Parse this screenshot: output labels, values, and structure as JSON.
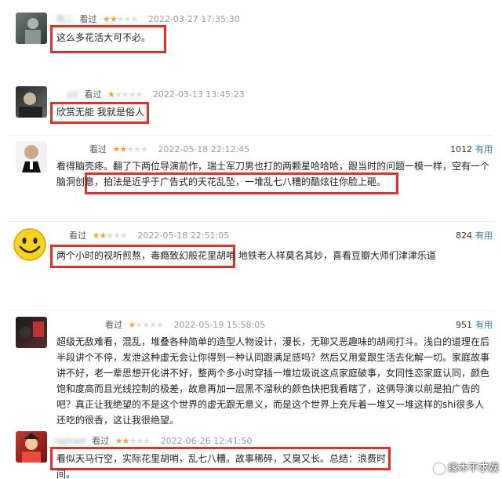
{
  "reviews": [
    {
      "user": "陈二",
      "watched": "看过",
      "stars": 2,
      "time": "2022-03-27 17:35:30",
      "text_before": "",
      "highlight": "这么多花活大可不必。",
      "text_after": "",
      "votes": "",
      "useful": ""
    },
    {
      "user": "p2",
      "watched": "看过",
      "stars": 1,
      "time": "2022-03-13 13:45:23",
      "text_before": "",
      "highlight": "欣赏无能 我就是俗人",
      "text_after": "",
      "votes": "",
      "useful": ""
    },
    {
      "user": "",
      "watched": "看过",
      "stars": 2,
      "time": "2022-05-18 22:12:45",
      "text_before": "看得脑壳疼。翻了下两位导演前作，瑞士军刀男也打的两颗星哈哈哈，跟当时的问题一模一样，空有一个脑洞创意，",
      "highlight": "拍法是近乎于广告式的天花乱坠，一堆乱七八糟的酷炫往你脸上砸。",
      "text_after": "",
      "votes": "1012",
      "useful": "有用"
    },
    {
      "user": "",
      "watched": "看过",
      "stars": 2,
      "time": "2022-05-18 22:51:05",
      "text_before": "",
      "highlight": "两个小时的视听煎熬，毒瘾致幻般花里胡哨",
      "text_after": " 地铁老人样莫名其妙，喜看豆瓣大师们津津乐道",
      "votes": "824",
      "useful": "有用"
    },
    {
      "user": "",
      "watched": "看过",
      "stars": 1,
      "time": "2022-05-19 15:58:05",
      "text_before": "超级无敌难看，混乱，堆叠各种简单的造型人物设计，漫长，无聊又恶趣味的胡闹打斗。浅白的道理在后半段讲个不停，发泄这种虚无会让你得到一种认同跟满足感吗？然后又用爱跟生活去化解一切。家庭故事讲不好，老一辈思想开化讲不好，整两个多小时穿插一堆垃圾说这点家庭破事，女同性恋家庭认同，颜色饱和度高而且光线控制的极差，故意再加一层黑不溜秋的颜色快把我看瞎了，这俩导演以前是拍广告的吧？真正让我绝望的不是这个世界的虚无跟无意义，而是这个世界上充斥着一堆又一堆这样的shi很多人还吃的很香，这让我很绝望。",
      "highlight": "",
      "text_after": "",
      "votes": "951",
      "useful": "有用"
    },
    {
      "user": "raphael",
      "watched": "看过",
      "stars": 2,
      "time": "2022-06-26 12:41:50",
      "text_before": "",
      "highlight": "看似天马行空，实际花里胡哨，乱七八糟。故事稀碎，又臭又长。总结：浪费时间。",
      "text_after": "",
      "votes": "",
      "useful": ""
    }
  ],
  "watermark": "缘木不求娱",
  "colors": {
    "star_on": "#f5a623",
    "highlight_box": "#e0302b",
    "useful_link": "#3377aa"
  }
}
